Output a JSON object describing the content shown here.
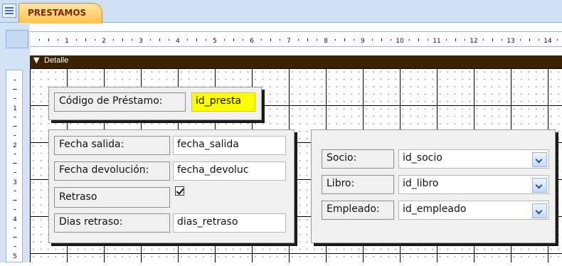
{
  "tab": {
    "title": "PRESTAMOS"
  },
  "section": {
    "title": "Detalle"
  },
  "ruler": {
    "horizontal_numbers": [
      "1",
      "2",
      "3",
      "4",
      "5",
      "6",
      "7",
      "8",
      "9",
      "10",
      "11",
      "12",
      "13",
      "14"
    ],
    "vertical_numbers": [
      "1",
      "2",
      "3",
      "4",
      "5"
    ]
  },
  "form": {
    "codigo": {
      "label": "Código de Préstamo:",
      "field": "id_presta"
    },
    "fecha_salida": {
      "label": "Fecha salida:",
      "field": "fecha_salida"
    },
    "fecha_devolucion": {
      "label": "Fecha devolución:",
      "field": "fecha_devoluc"
    },
    "retraso": {
      "label": "Retraso",
      "checked": true
    },
    "dias_retraso": {
      "label": "Dias retraso:",
      "field": "dias_retraso"
    },
    "socio": {
      "label": "Socio:",
      "field": "id_socio"
    },
    "libro": {
      "label": "Libro:",
      "field": "id_libro"
    },
    "empleado": {
      "label": "Empleado:",
      "field": "id_empleado"
    }
  },
  "colors": {
    "tab_fill": "#ffc24d",
    "section_bar": "#3c2200",
    "highlight_field": "#ffff00"
  }
}
